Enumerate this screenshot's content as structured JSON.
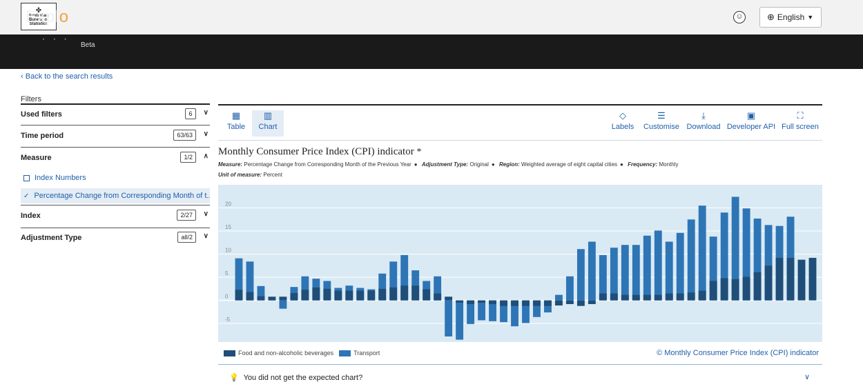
{
  "logo": {
    "lines": [
      "Australian",
      "Bureau of",
      "Statistics"
    ]
  },
  "language": {
    "label": "English"
  },
  "brand": {
    "name_pre": "Expl",
    "name_o": "o",
    "name_post": "rer",
    "beta": "Beta"
  },
  "nav": {
    "back": "Back to the search results"
  },
  "filters": {
    "title": "Filters",
    "rows": [
      {
        "label": "Used filters",
        "badge": "6"
      },
      {
        "label": "Time period",
        "badge": "63/63"
      },
      {
        "label": "Measure",
        "badge": "1/2"
      },
      {
        "label": "Index",
        "badge": "2/27"
      },
      {
        "label": "Adjustment Type",
        "badge": "all/2"
      }
    ],
    "measure_options": [
      {
        "label": "Index Numbers",
        "selected": false
      },
      {
        "label": "Percentage Change from Corresponding Month of t...",
        "selected": true
      }
    ]
  },
  "toolbar": {
    "table": "Table",
    "chart": "Chart",
    "labels": "Labels",
    "customise": "Customise",
    "download": "Download",
    "developer_api": "Developer API",
    "full_screen": "Full screen"
  },
  "chart_header": {
    "title": "Monthly Consumer Price Index (CPI) indicator",
    "asterisk": "*",
    "measure_key": "Measure:",
    "measure_val": "Percentage Change from Corresponding Month of the Previous Year",
    "adj_key": "Adjustment Type:",
    "adj_val": "Original",
    "region_key": "Region:",
    "region_val": "Weighted average of eight capital cities",
    "freq_key": "Frequency:",
    "freq_val": "Monthly",
    "unit_key": "Unit of measure:",
    "unit_val": "Percent"
  },
  "colors": {
    "plot_bg": "#d9eaf4",
    "grid": "#ffffff",
    "food": "#1f4e79",
    "transport": "#2e75b6"
  },
  "chart_data": {
    "type": "bar",
    "stacking": "overlay",
    "ylim": [
      -9,
      25
    ],
    "yticks": [
      -5,
      0,
      5,
      10,
      15,
      20
    ],
    "grid": true,
    "legend_position": "bottom-left",
    "series": [
      {
        "name": "Food and non-alcoholic beverages",
        "values": [
          2.3,
          1.8,
          0.9,
          0.8,
          0.8,
          1.6,
          2.3,
          2.8,
          2.5,
          2.1,
          2.1,
          2.1,
          2.1,
          2.5,
          2.8,
          3.2,
          3.2,
          2.4,
          1.5,
          0.8,
          -0.5,
          -0.8,
          -0.5,
          -0.8,
          -1.2,
          -1.2,
          -1.2,
          -1.2,
          -1.2,
          -1.1,
          -0.8,
          -1.2,
          -0.8,
          1.5,
          1.5,
          1.2,
          1.2,
          1.2,
          1.2,
          1.5,
          1.5,
          1.7,
          2.1,
          4.2,
          4.8,
          4.6,
          5.1,
          6.1,
          7.5,
          9.2,
          9.2,
          8.8,
          9.2
        ]
      },
      {
        "name": "Transport",
        "values": [
          9.1,
          8.4,
          3.1,
          0.2,
          -1.8,
          2.9,
          5.2,
          4.7,
          4.2,
          2.7,
          3.2,
          2.7,
          2.4,
          5.8,
          8.4,
          9.8,
          6.5,
          4.2,
          5.2,
          -7.8,
          -8.5,
          -5.1,
          -4.3,
          -4.5,
          -4.7,
          -5.6,
          -4.9,
          -3.6,
          -2.6,
          1.2,
          5.2,
          11.1,
          12.7,
          9.8,
          11.4,
          12.0,
          12.0,
          14.0,
          15.1,
          12.7,
          14.6,
          17.5,
          20.5,
          13.8,
          19.0,
          22.4,
          19.9,
          17.7,
          16.3,
          16.1,
          18.1
        ]
      }
    ]
  },
  "legend": {
    "food": "Food and non-alcoholic beverages",
    "transport": "Transport",
    "copyright": "© Monthly Consumer Price Index (CPI) indicator"
  },
  "hint": {
    "text": "You did not get the expected chart?"
  }
}
